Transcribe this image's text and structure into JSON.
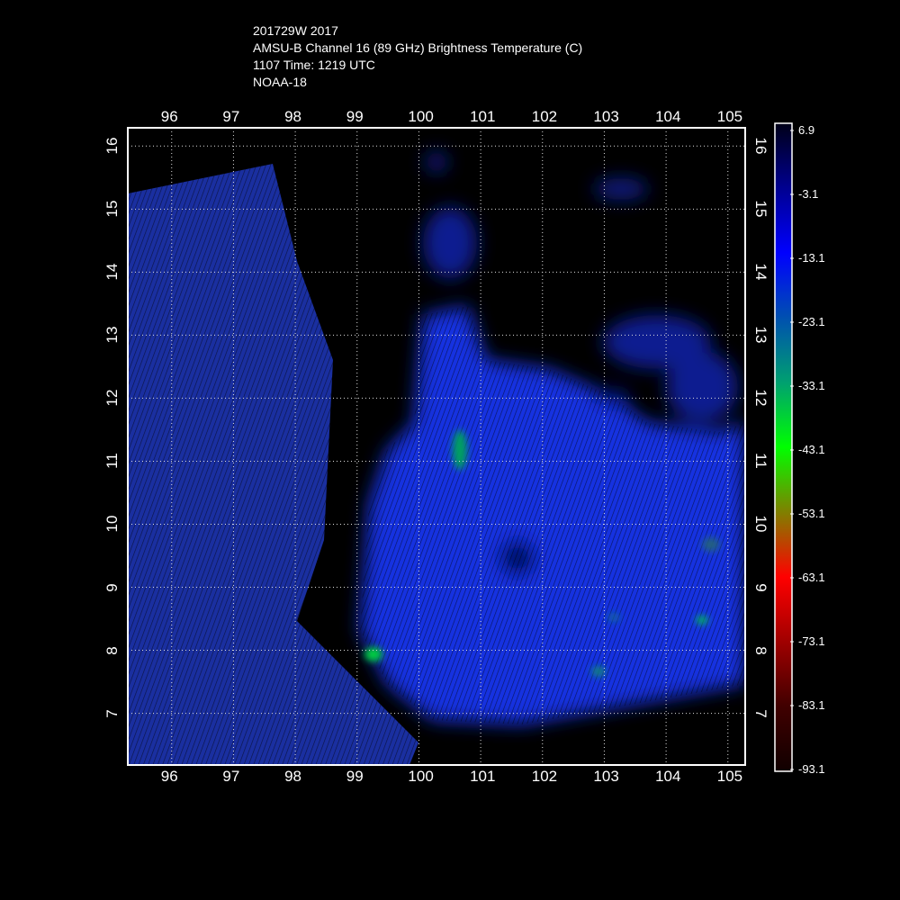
{
  "header": {
    "line1": "201729W 2017",
    "line2": "AMSU-B Channel 16 (89 GHz) Brightness Temperature (C)",
    "line3": "1107 Time: 1219 UTC",
    "line4": "NOAA-18"
  },
  "map": {
    "lon_range": [
      95.29,
      105.28
    ],
    "lat_range": [
      6.18,
      16.29
    ],
    "lon_ticks": [
      "96",
      "97",
      "98",
      "99",
      "100",
      "101",
      "102",
      "103",
      "104",
      "105"
    ],
    "lat_ticks": [
      "16",
      "15",
      "14",
      "13",
      "12",
      "11",
      "10",
      "9",
      "8",
      "7"
    ],
    "grid": true
  },
  "colorbar": {
    "labels": [
      "6.9",
      "-3.1",
      "-13.1",
      "-23.1",
      "-33.1",
      "-43.1",
      "-53.1",
      "-63.1",
      "-73.1",
      "-83.1",
      "-93.1"
    ],
    "colors": [
      "#000018",
      "#000090",
      "#0000ff",
      "#0050b0",
      "#00a070",
      "#00ff00",
      "#808000",
      "#ff0000",
      "#a00000",
      "#400000",
      "#100000"
    ]
  }
}
